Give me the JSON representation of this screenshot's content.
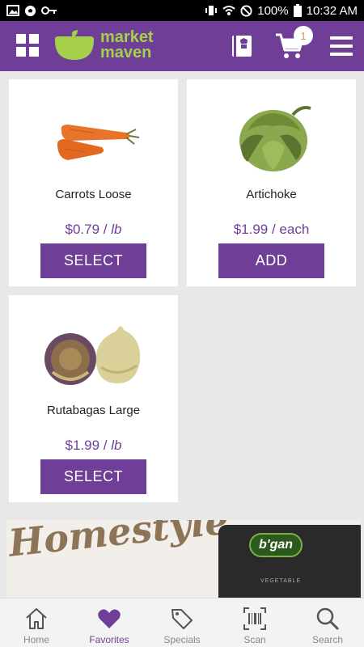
{
  "status_bar": {
    "battery": "100%",
    "time": "10:32 AM"
  },
  "header": {
    "logo_line1": "market",
    "logo_line2": "maven",
    "cart_count": "1"
  },
  "products": [
    {
      "name": "Carrots Loose",
      "price": "$0.79",
      "unit": "lb",
      "button": "SELECT"
    },
    {
      "name": "Artichoke",
      "price": "$1.99",
      "unit": "each",
      "button": "ADD"
    },
    {
      "name": "Rutabagas Large",
      "price": "$1.99",
      "unit": "lb",
      "button": "SELECT"
    }
  ],
  "banner": {
    "headline": "Homestyle",
    "brand": "b'gan",
    "sub": "VEGETABLE"
  },
  "bottom_nav": {
    "items": [
      {
        "label": "Home",
        "icon": "home-icon"
      },
      {
        "label": "Favorites",
        "icon": "heart-icon"
      },
      {
        "label": "Specials",
        "icon": "tag-icon"
      },
      {
        "label": "Scan",
        "icon": "barcode-icon"
      },
      {
        "label": "Search",
        "icon": "search-icon"
      }
    ],
    "active": "Favorites"
  },
  "colors": {
    "brand_purple": "#6f3f97",
    "logo_green": "#a6cf4a",
    "badge_orange": "#e8914a"
  }
}
